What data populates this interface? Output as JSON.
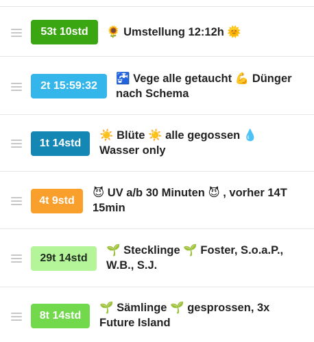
{
  "items": [
    {
      "badge": "53t 10std",
      "badge_color": "#3aa712",
      "badge_text_color": "#ffffff",
      "line1": "🌻 Umstellung 12:12h 🌞",
      "line2": ""
    },
    {
      "badge": "2t 15:59:32",
      "badge_color": "#34b6ea",
      "badge_text_color": "#ffffff",
      "line1": "🚰 Vege alle getaucht 💪 Dünger",
      "line2": "nach Schema"
    },
    {
      "badge": "1t 14std",
      "badge_color": "#1487b4",
      "badge_text_color": "#ffffff",
      "line1": "☀️ Blüte ☀️ alle gegossen 💧",
      "line2": "Wasser only"
    },
    {
      "badge": "4t 9std",
      "badge_color": "#f9a02c",
      "badge_text_color": "#ffffff",
      "line1": "😈 UV a/b 30 Minuten 😈 , vorher 14T",
      "line2": "15min"
    },
    {
      "badge": "29t 14std",
      "badge_color": "#b5f59a",
      "badge_text_color": "#1f2b1f",
      "line1": "🌱 Stecklinge 🌱 Foster, S.o.a.P.,",
      "line2": "W.B., S.J."
    },
    {
      "badge": "8t 14std",
      "badge_color": "#72d94d",
      "badge_text_color": "#ffffff",
      "line1": "🌱 Sämlinge 🌱 gesprossen, 3x",
      "line2": "Future Island"
    }
  ]
}
